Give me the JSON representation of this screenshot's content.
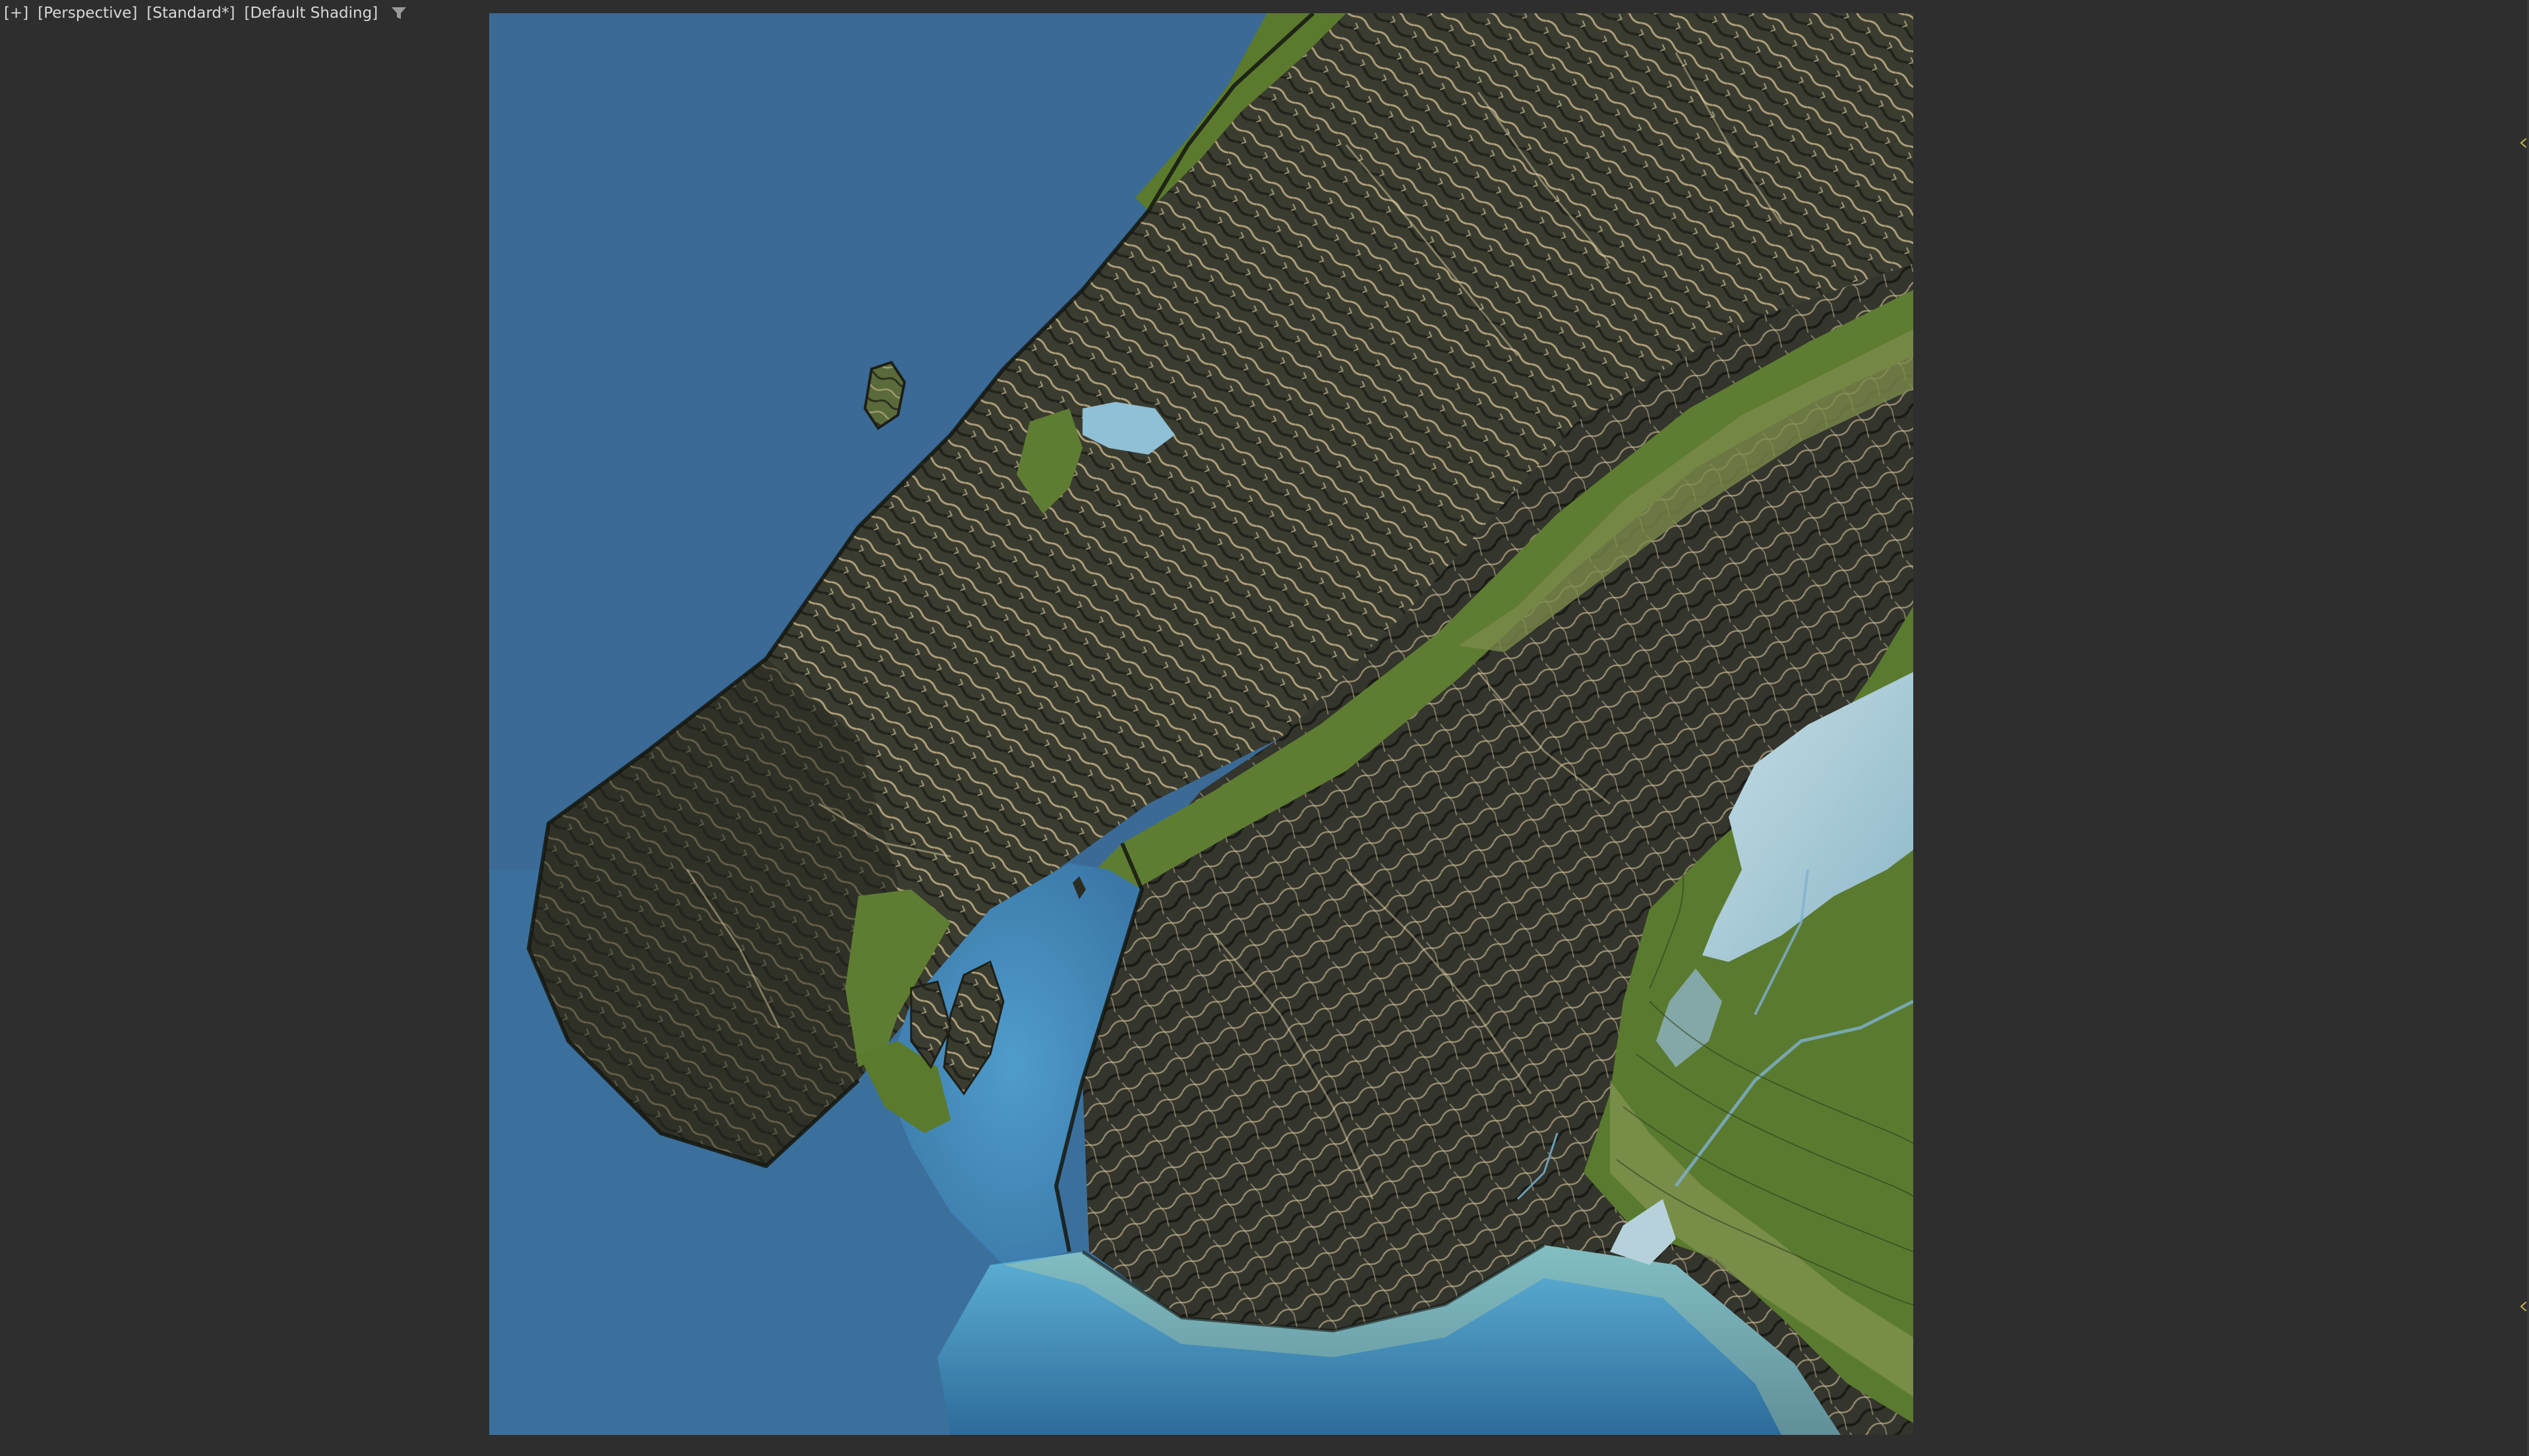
{
  "viewport": {
    "labels": {
      "plus": "[+]",
      "view": "[Perspective]",
      "mode": "[Standard*]",
      "shading": "[Default Shading]"
    },
    "icons": {
      "filter": "filter-icon"
    },
    "colors": {
      "background": "#2e2e2e",
      "ocean": "#3a6a95",
      "shallow_water": "#4e9cc8",
      "lowland": "#5a7a30",
      "ridge": "#d8c8a0",
      "mountain_shadow": "#2e3026",
      "lake": "#a9c9d6"
    }
  }
}
